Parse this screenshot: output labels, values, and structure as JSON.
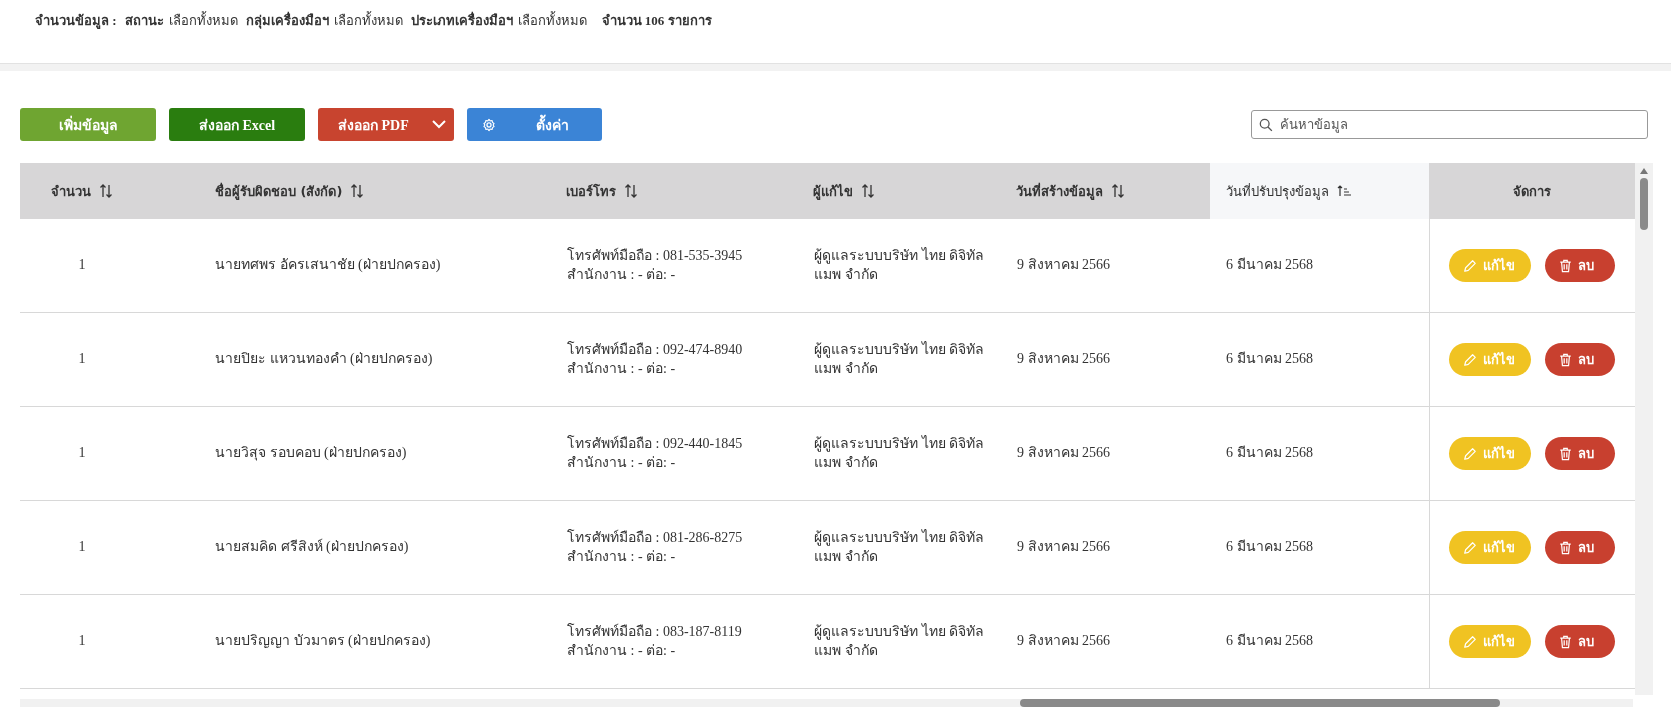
{
  "summary": {
    "label": "จำนวนข้อมูล :",
    "filters": [
      {
        "name": "สถานะ",
        "value": "เลือกทั้งหมด"
      },
      {
        "name": "กลุ่มเครื่องมือฯ",
        "value": "เลือกทั้งหมด"
      },
      {
        "name": "ประเภทเครื่องมือฯ",
        "value": "เลือกทั้งหมด"
      }
    ],
    "total": "จำนวน 106 รายการ"
  },
  "toolbar": {
    "buttons": [
      {
        "label": "เพิ่มข้อมูล",
        "kind": "add"
      },
      {
        "label": "ส่งออก Excel",
        "kind": "excel"
      },
      {
        "label": "ส่งออก PDF",
        "kind": "pdf"
      },
      {
        "label": "ตั้งค่า",
        "kind": "settings"
      }
    ],
    "search": {
      "placeholder": "ค้นหาข้อมูล"
    }
  },
  "table": {
    "columns": [
      {
        "label": "จำนวน",
        "kind": "sortable",
        "selected": false
      },
      {
        "label": "ชื่อผู้รับผิดชอบ (สังกัด)",
        "kind": "sortable",
        "selected": false
      },
      {
        "label": "เบอร์โทร",
        "kind": "sortable",
        "selected": false
      },
      {
        "label": "ผู้แก้ไข",
        "kind": "sortable",
        "selected": false
      },
      {
        "label": "วันที่สร้างข้อมูล",
        "kind": "sortable",
        "selected": false
      },
      {
        "label": "วันที่ปรับปรุงข้อมูล",
        "kind": "sorted",
        "selected": true
      },
      {
        "label": "จัดการ",
        "kind": "plain",
        "selected": false
      }
    ],
    "rows": [
      {
        "number": "1",
        "name": "นายทศพร อัครเสนาชัย (ฝ่ายปกครอง)",
        "mobile": "โทรศัพท์มือถือ : 081-535-3945",
        "office": "สำนักงาน : - ต่อ: -",
        "editor": "ผู้ดูแลระบบบริษัท ไทย ดิจิทัล แมพ จำกัด",
        "created": "9 สิงหาคม 2566",
        "updated": "6 มีนาคม 2568",
        "edit": "แก้ไข",
        "delete": "ลบ"
      },
      {
        "number": "1",
        "name": "นายปิยะ แหวนทองคำ (ฝ่ายปกครอง)",
        "mobile": "โทรศัพท์มือถือ : 092-474-8940",
        "office": "สำนักงาน : - ต่อ: -",
        "editor": "ผู้ดูแลระบบบริษัท ไทย ดิจิทัล แมพ จำกัด",
        "created": "9 สิงหาคม 2566",
        "updated": "6 มีนาคม 2568",
        "edit": "แก้ไข",
        "delete": "ลบ"
      },
      {
        "number": "1",
        "name": "นายวิสุจ รอบคอบ (ฝ่ายปกครอง)",
        "mobile": "โทรศัพท์มือถือ : 092-440-1845",
        "office": "สำนักงาน : - ต่อ: -",
        "editor": "ผู้ดูแลระบบบริษัท ไทย ดิจิทัล แมพ จำกัด",
        "created": "9 สิงหาคม 2566",
        "updated": "6 มีนาคม 2568",
        "edit": "แก้ไข",
        "delete": "ลบ"
      },
      {
        "number": "1",
        "name": "นายสมคิด ศรีสิงห์ (ฝ่ายปกครอง)",
        "mobile": "โทรศัพท์มือถือ : 081-286-8275",
        "office": "สำนักงาน : - ต่อ: -",
        "editor": "ผู้ดูแลระบบบริษัท ไทย ดิจิทัล แมพ จำกัด",
        "created": "9 สิงหาคม 2566",
        "updated": "6 มีนาคม 2568",
        "edit": "แก้ไข",
        "delete": "ลบ"
      },
      {
        "number": "1",
        "name": "นายปริญญา บัวมาตร (ฝ่ายปกครอง)",
        "mobile": "โทรศัพท์มือถือ : 083-187-8119",
        "office": "สำนักงาน : - ต่อ: -",
        "editor": "ผู้ดูแลระบบบริษัท ไทย ดิจิทัล แมพ จำกัด",
        "created": "9 สิงหาคม 2566",
        "updated": "6 มีนาคม 2568",
        "edit": "แก้ไข",
        "delete": "ลบ"
      }
    ]
  }
}
